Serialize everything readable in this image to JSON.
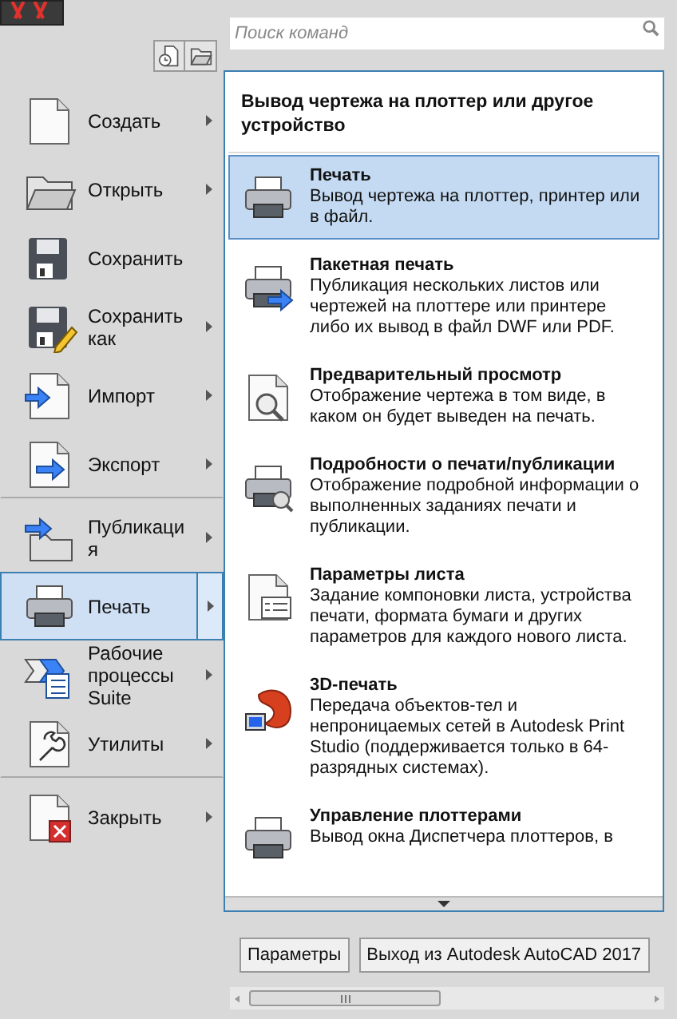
{
  "search": {
    "placeholder": "Поиск команд"
  },
  "menu": [
    {
      "label": "Создать",
      "submenu": true,
      "selected": false
    },
    {
      "label": "Открыть",
      "submenu": true,
      "selected": false
    },
    {
      "label": "Сохранить",
      "submenu": false,
      "selected": false
    },
    {
      "label": "Сохранить как",
      "submenu": true,
      "selected": false
    },
    {
      "label": "Импорт",
      "submenu": true,
      "selected": false
    },
    {
      "label": "Экспорт",
      "submenu": true,
      "selected": false,
      "divider_after": true
    },
    {
      "label": "Публикаци я",
      "submenu": true,
      "selected": false
    },
    {
      "label": "Печать",
      "submenu": true,
      "selected": true
    },
    {
      "label": "Рабочие процессы Suite",
      "submenu": true,
      "selected": false
    },
    {
      "label": "Утилиты",
      "submenu": true,
      "selected": false,
      "divider_after": true
    },
    {
      "label": "Закрыть",
      "submenu": true,
      "selected": false
    }
  ],
  "panel": {
    "title": "Вывод чертежа на плоттер или другое устройство",
    "items": [
      {
        "title": "Печать",
        "description": "Вывод чертежа на плоттер, принтер или в файл.",
        "selected": true
      },
      {
        "title": "Пакетная печать",
        "description": "Публикация нескольких листов или чертежей на плоттере или принтере либо их вывод в файл DWF или PDF.",
        "selected": false
      },
      {
        "title": "Предварительный просмотр",
        "description": "Отображение чертежа в том виде, в каком он будет выведен на печать.",
        "selected": false
      },
      {
        "title": "Подробности о печати/публикации",
        "description": "Отображение подробной информации о выполненных заданиях печати и публикации.",
        "selected": false
      },
      {
        "title": "Параметры листа",
        "description": "Задание компоновки листа, устройства печати, формата бумаги и других параметров для каждого нового листа.",
        "selected": false
      },
      {
        "title": "3D-печать",
        "description": "Передача объектов-тел и непроницаемых сетей в Autodesk Print Studio (поддерживается только в 64-разрядных системах).",
        "selected": false
      },
      {
        "title": "Управление плоттерами",
        "description": "Вывод окна Диспетчера плоттеров, в",
        "selected": false
      }
    ]
  },
  "buttons": [
    "Параметры",
    "Выход из Autodesk AutoCAD 2017"
  ]
}
